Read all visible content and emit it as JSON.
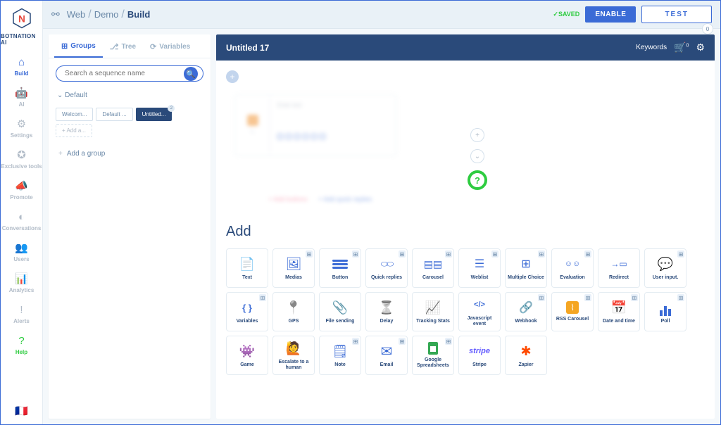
{
  "brand": "BOTNATION AI",
  "nav": [
    {
      "label": "Build",
      "icon": "⌂",
      "active": true
    },
    {
      "label": "AI",
      "icon": "🤖"
    },
    {
      "label": "Settings",
      "icon": "⚙"
    },
    {
      "label": "Exclusive tools",
      "icon": "✪"
    },
    {
      "label": "Promote",
      "icon": "📣"
    },
    {
      "label": "Conversations",
      "icon": "◐"
    },
    {
      "label": "Users",
      "icon": "👥"
    },
    {
      "label": "Analytics",
      "icon": "📊"
    },
    {
      "label": "Alerts",
      "icon": "!"
    },
    {
      "label": "Help",
      "icon": "?",
      "help": true
    }
  ],
  "breadcrumb": {
    "root_icon": "⚯",
    "parts": [
      "Web",
      "Demo",
      "Build"
    ]
  },
  "topbar": {
    "saved": "✓SAVED",
    "enable": "ENABLE",
    "test": "TEST",
    "zero": "0"
  },
  "tabs": [
    {
      "label": "Groups",
      "icon": "⊞",
      "active": true
    },
    {
      "label": "Tree",
      "icon": "⎇"
    },
    {
      "label": "Variables",
      "icon": "⟳"
    }
  ],
  "search_placeholder": "Search a sequence name",
  "group_name": "⌄ Default",
  "chips": [
    {
      "label": "Welcom..."
    },
    {
      "label": "Default ..."
    },
    {
      "label": "Untitled...",
      "active": true,
      "badge": "2"
    },
    {
      "label": "+ Add a...",
      "add": true
    }
  ],
  "add_group": "Add a group",
  "sequence": {
    "title": "Untitled 17",
    "keywords": "Keywords",
    "cart_count": "0"
  },
  "question_mark": "?",
  "add_title": "Add",
  "cards": [
    {
      "label": "Text",
      "ico": "ico-text"
    },
    {
      "label": "Medias",
      "ico": "ico-medias",
      "plus": true
    },
    {
      "label": "Button",
      "ico": "ico-button",
      "bars": true,
      "plus": true
    },
    {
      "label": "Quick replies",
      "ico": "ico-quick",
      "plus": true
    },
    {
      "label": "Carousel",
      "ico": "ico-carousel",
      "plus": true
    },
    {
      "label": "Weblist",
      "ico": "ico-weblist",
      "plus": true
    },
    {
      "label": "Multiple Choice",
      "ico": "ico-multi",
      "plus": true
    },
    {
      "label": "Evaluation",
      "ico": "ico-eval",
      "plus": true
    },
    {
      "label": "Redirect",
      "ico": "ico-redirect"
    },
    {
      "label": "User input.",
      "ico": "ico-input",
      "plus": true
    },
    {
      "label": "Variables",
      "ico": "ico-var",
      "plus": true
    },
    {
      "label": "GPS",
      "ico": "ico-gps"
    },
    {
      "label": "File sending",
      "ico": "ico-file"
    },
    {
      "label": "Delay",
      "ico": "ico-delay"
    },
    {
      "label": "Tracking Stats",
      "ico": "ico-track"
    },
    {
      "label": "Javascript event",
      "ico": "ico-js"
    },
    {
      "label": "Webhook",
      "ico": "ico-webhook",
      "emoji": "🔗",
      "plus": true
    },
    {
      "label": "RSS Carousel",
      "ico": "ico-rss",
      "emoji": "⌇",
      "plus": true
    },
    {
      "label": "Date and time",
      "ico": "ico-date",
      "plus": true
    },
    {
      "label": "Poll",
      "ico": "ico-poll",
      "bars3": true,
      "plus": true
    },
    {
      "label": "Game",
      "ico": "ico-game"
    },
    {
      "label": "Escalate to a human",
      "ico": "ico-escalate"
    },
    {
      "label": "Note",
      "ico": "ico-note",
      "plus": true
    },
    {
      "label": "Email",
      "ico": "ico-email",
      "plus": true
    },
    {
      "label": "Google Spreadsheets",
      "ico": "ico-gsheet",
      "box": true,
      "plus": true
    },
    {
      "label": "Stripe",
      "ico": "ico-stripe",
      "emoji": "stripe"
    },
    {
      "label": "Zapier",
      "ico": "ico-zapier",
      "emoji": "✱"
    }
  ]
}
